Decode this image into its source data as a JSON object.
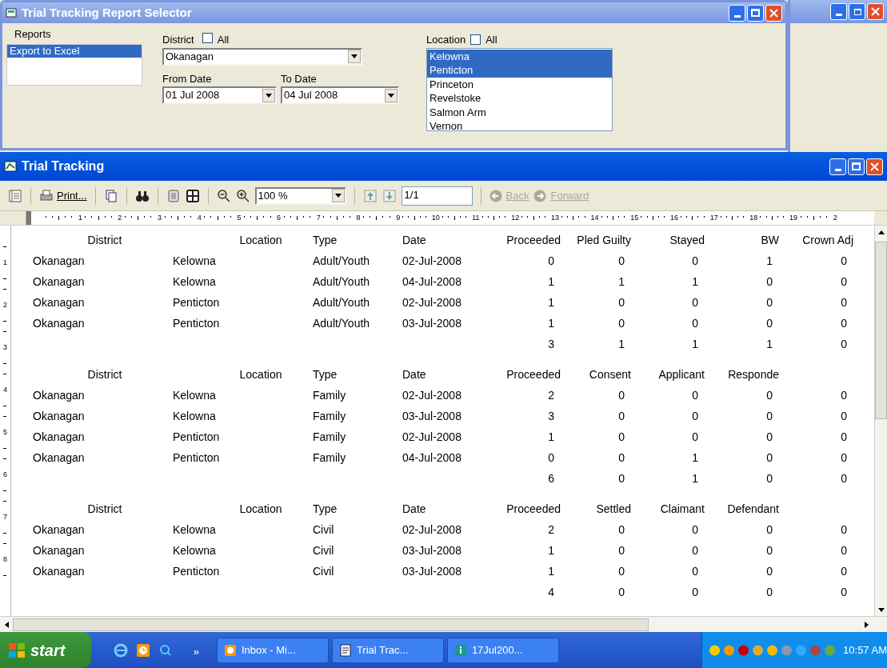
{
  "selector": {
    "title": "Trial Tracking Report Selector",
    "reports": {
      "label": "Reports",
      "items": [
        {
          "label": "Export to Excel",
          "selected": true
        }
      ]
    },
    "district": {
      "label": "District",
      "all_label": "All",
      "all_checked": false,
      "value": "Okanagan"
    },
    "from_date": {
      "label": "From Date",
      "value": "01 Jul 2008"
    },
    "to_date": {
      "label": "To Date",
      "value": "04 Jul 2008"
    },
    "location": {
      "label": "Location",
      "all_label": "All",
      "all_checked": false,
      "items": [
        {
          "label": "Kelowna",
          "selected": true
        },
        {
          "label": "Penticton",
          "selected": true
        },
        {
          "label": "Princeton",
          "selected": false
        },
        {
          "label": "Revelstoke",
          "selected": false
        },
        {
          "label": "Salmon Arm",
          "selected": false
        },
        {
          "label": "Vernon",
          "selected": false
        }
      ]
    }
  },
  "viewer": {
    "title": "Trial Tracking",
    "toolbar": {
      "print_label": "Print...",
      "zoom": "100 %",
      "page": "1/1",
      "back": {
        "label": "Back",
        "disabled": true
      },
      "forward": {
        "label": "Forward",
        "disabled": true
      }
    },
    "ruler": [
      "1",
      "2",
      "3",
      "4",
      "5",
      "6",
      "7",
      "8",
      "9",
      "10",
      "11",
      "12",
      "13",
      "14",
      "15",
      "16",
      "17",
      "18",
      "19",
      "2"
    ],
    "vruler": [
      "1",
      "2",
      "3",
      "4",
      "5",
      "6",
      "7",
      "8"
    ],
    "sections": [
      {
        "headers": [
          "District",
          "Location",
          "Type",
          "Date",
          "Proceeded",
          "Pled Guilty",
          "Stayed",
          "BW",
          "Crown Adj"
        ],
        "rows": [
          [
            "Okanagan",
            "Kelowna",
            "Adult/Youth",
            "02-Jul-2008",
            "0",
            "0",
            "0",
            "1",
            "0"
          ],
          [
            "Okanagan",
            "Kelowna",
            "Adult/Youth",
            "04-Jul-2008",
            "1",
            "1",
            "1",
            "0",
            "0"
          ],
          [
            "Okanagan",
            "Penticton",
            "Adult/Youth",
            "02-Jul-2008",
            "1",
            "0",
            "0",
            "0",
            "0"
          ],
          [
            "Okanagan",
            "Penticton",
            "Adult/Youth",
            "03-Jul-2008",
            "1",
            "0",
            "0",
            "0",
            "0"
          ]
        ],
        "totals": [
          "3",
          "1",
          "1",
          "1",
          "0"
        ]
      },
      {
        "headers": [
          "District",
          "Location",
          "Type",
          "Date",
          "Proceeded",
          "Consent",
          "Applicant",
          "Responde"
        ],
        "rows": [
          [
            "Okanagan",
            "Kelowna",
            "Family",
            "02-Jul-2008",
            "2",
            "0",
            "0",
            "0",
            "0"
          ],
          [
            "Okanagan",
            "Kelowna",
            "Family",
            "03-Jul-2008",
            "3",
            "0",
            "0",
            "0",
            "0"
          ],
          [
            "Okanagan",
            "Penticton",
            "Family",
            "02-Jul-2008",
            "1",
            "0",
            "0",
            "0",
            "0"
          ],
          [
            "Okanagan",
            "Penticton",
            "Family",
            "04-Jul-2008",
            "0",
            "0",
            "1",
            "0",
            "0"
          ]
        ],
        "totals": [
          "6",
          "0",
          "1",
          "0",
          "0"
        ]
      },
      {
        "headers": [
          "District",
          "Location",
          "Type",
          "Date",
          "Proceeded",
          "Settled",
          "Claimant",
          "Defendant"
        ],
        "rows": [
          [
            "Okanagan",
            "Kelowna",
            "Civil",
            "02-Jul-2008",
            "2",
            "0",
            "0",
            "0",
            "0"
          ],
          [
            "Okanagan",
            "Kelowna",
            "Civil",
            "03-Jul-2008",
            "1",
            "0",
            "0",
            "0",
            "0"
          ],
          [
            "Okanagan",
            "Penticton",
            "Civil",
            "03-Jul-2008",
            "1",
            "0",
            "0",
            "0",
            "0"
          ]
        ],
        "totals": [
          "4",
          "0",
          "0",
          "0",
          "0"
        ]
      }
    ]
  },
  "taskbar": {
    "start": "start",
    "overflow": "»",
    "tasks": [
      {
        "label": "Inbox - Mi...",
        "kind": "mail"
      },
      {
        "label": "Trial Trac...",
        "kind": "doc"
      },
      {
        "label": "17Jul200...",
        "kind": "info"
      }
    ],
    "clock": "10:57 AM"
  }
}
